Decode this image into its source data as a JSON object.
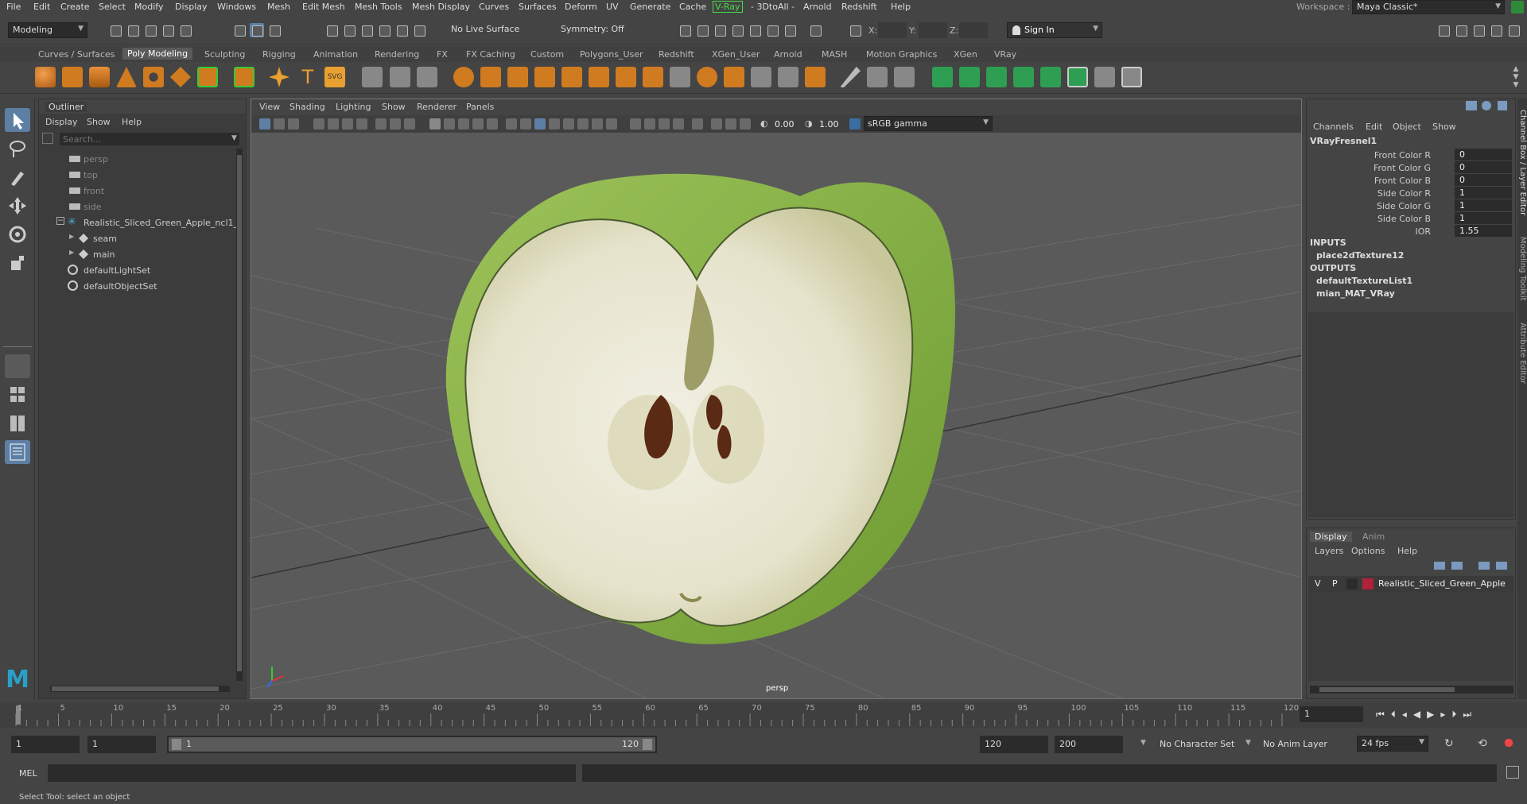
{
  "menubar": {
    "items": [
      "File",
      "Edit",
      "Create",
      "Select",
      "Modify",
      "Display",
      "Windows",
      "Mesh",
      "Edit Mesh",
      "Mesh Tools",
      "Mesh Display",
      "Curves",
      "Surfaces",
      "Deform",
      "UV",
      "Generate",
      "Cache",
      "V-Ray",
      "- 3DtoAll -",
      "Arnold",
      "Redshift",
      "Help"
    ],
    "workspace_label": "Workspace :",
    "workspace_value": "Maya Classic*"
  },
  "statusline": {
    "mode": "Modeling",
    "live_surface": "No Live Surface",
    "symmetry": "Symmetry: Off",
    "x_label": "X:",
    "y_label": "Y:",
    "z_label": "Z:",
    "sign_in": "Sign In"
  },
  "shelf": {
    "tabs": [
      "Curves / Surfaces",
      "Poly Modeling",
      "Sculpting",
      "Rigging",
      "Animation",
      "Rendering",
      "FX",
      "FX Caching",
      "Custom",
      "Polygons_User",
      "Redshift",
      "XGen_User",
      "Arnold",
      "MASH",
      "Motion Graphics",
      "XGen",
      "VRay"
    ],
    "active_tab": "Poly Modeling"
  },
  "outliner": {
    "title": "Outliner",
    "menu": [
      "Display",
      "Show",
      "Help"
    ],
    "search_placeholder": "Search...",
    "items": [
      {
        "label": "persp",
        "type": "camera",
        "indent": 0
      },
      {
        "label": "top",
        "type": "camera",
        "indent": 0
      },
      {
        "label": "front",
        "type": "camera",
        "indent": 0
      },
      {
        "label": "side",
        "type": "camera",
        "indent": 0
      },
      {
        "label": "Realistic_Sliced_Green_Apple_ncl1_1",
        "type": "group",
        "indent": 0
      },
      {
        "label": "seam",
        "type": "mesh",
        "indent": 1
      },
      {
        "label": "main",
        "type": "mesh",
        "indent": 1
      },
      {
        "label": "defaultLightSet",
        "type": "set",
        "indent": 0
      },
      {
        "label": "defaultObjectSet",
        "type": "set",
        "indent": 0
      }
    ]
  },
  "viewport": {
    "menu": [
      "View",
      "Shading",
      "Lighting",
      "Show",
      "Renderer",
      "Panels"
    ],
    "exposure": "0.00",
    "gamma": "1.00",
    "color_space": "sRGB gamma",
    "camera_label": "persp"
  },
  "channelbox": {
    "menu": [
      "Channels",
      "Edit",
      "Object",
      "Show"
    ],
    "node": "VRayFresnel1",
    "attrs": [
      {
        "label": "Front Color R",
        "value": "0"
      },
      {
        "label": "Front Color G",
        "value": "0"
      },
      {
        "label": "Front Color B",
        "value": "0"
      },
      {
        "label": "Side Color R",
        "value": "1"
      },
      {
        "label": "Side Color G",
        "value": "1"
      },
      {
        "label": "Side Color B",
        "value": "1"
      },
      {
        "label": "IOR",
        "value": "1.55"
      }
    ],
    "inputs_label": "INPUTS",
    "inputs": [
      "place2dTexture12"
    ],
    "outputs_label": "OUTPUTS",
    "outputs": [
      "defaultTextureList1",
      "mian_MAT_VRay"
    ],
    "side_tabs": [
      "Channel Box / Layer Editor",
      "Modeling Toolkit",
      "Attribute Editor"
    ]
  },
  "layers": {
    "tabs": [
      "Display",
      "Anim"
    ],
    "menu": [
      "Layers",
      "Options",
      "Help"
    ],
    "layer": {
      "v": "V",
      "p": "P",
      "name": "Realistic_Sliced_Green_Apple",
      "color": "#b0213a"
    }
  },
  "timeline": {
    "ticks": [
      "1",
      "5",
      "10",
      "15",
      "20",
      "25",
      "30",
      "35",
      "40",
      "45",
      "50",
      "55",
      "60",
      "65",
      "70",
      "75",
      "80",
      "85",
      "90",
      "95",
      "100",
      "105",
      "110",
      "115",
      "120"
    ],
    "current_frame": "1"
  },
  "range": {
    "start": "1",
    "playback_start": "1",
    "slider_start": "1",
    "slider_end": "120",
    "playback_end": "120",
    "end": "200",
    "character_set": "No Character Set",
    "anim_layer": "No Anim Layer",
    "fps": "24 fps"
  },
  "cmdline": {
    "label": "MEL"
  },
  "helpline": {
    "text": "Select Tool: select an object"
  },
  "colors": {
    "accent": "#5d7fa4",
    "vray": "#44dd44",
    "layer": "#b0213a"
  }
}
